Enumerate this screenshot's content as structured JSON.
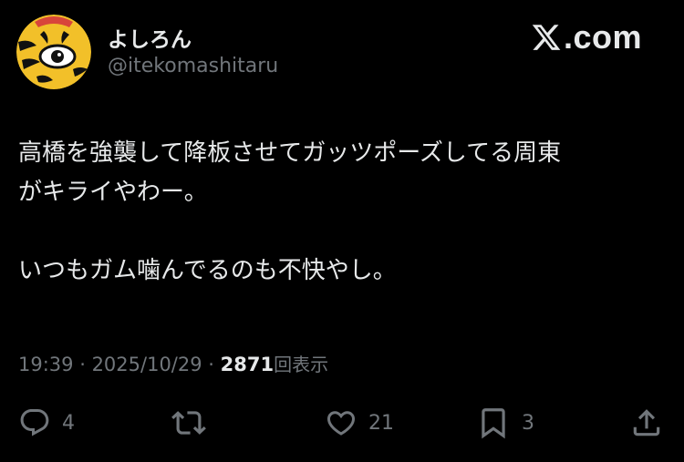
{
  "author": {
    "display_name": "よしろん",
    "handle": "@itekomashitaru",
    "avatar_icon": "tiger-avatar-icon"
  },
  "brand": {
    "text": ".com",
    "icon": "x-logo-icon"
  },
  "tweet": {
    "lines": [
      "高橋を強襲して降板させてガッツポーズしてる周東",
      "がキライやわー。",
      "",
      "いつもガム噛んでるのも不快やし。"
    ]
  },
  "meta": {
    "time": "19:39",
    "sep1": " · ",
    "date": "2025/10/29",
    "sep2": " · ",
    "views_count": "2871",
    "views_label": "回表示"
  },
  "actions": {
    "reply": {
      "icon": "reply-icon",
      "count": "4"
    },
    "retweet": {
      "icon": "retweet-icon"
    },
    "like": {
      "icon": "heart-icon",
      "count": "21"
    },
    "bookmark": {
      "icon": "bookmark-icon",
      "count": "3"
    },
    "share": {
      "icon": "share-icon"
    }
  },
  "colors": {
    "background": "#000000",
    "text_primary": "#e7e9ea",
    "text_secondary": "#71767b",
    "avatar_yellow": "#f2c029",
    "avatar_red": "#d8453a"
  }
}
